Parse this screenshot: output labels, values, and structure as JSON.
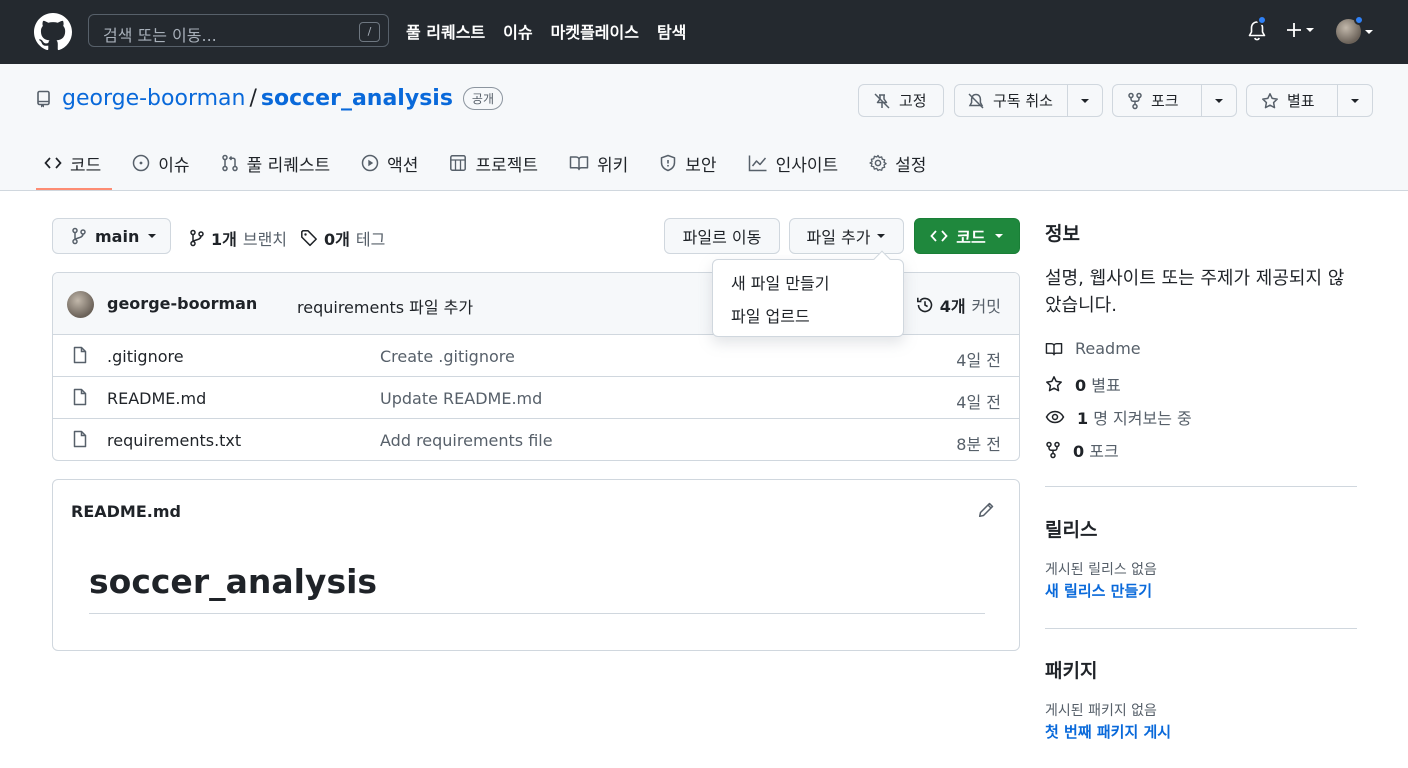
{
  "header": {
    "search_placeholder": "검색 또는 이동...",
    "search_shortcut": "/",
    "nav": [
      "풀 리퀘스트",
      "이슈",
      "마켓플레이스",
      "탐색"
    ],
    "plus_label": "+"
  },
  "repo": {
    "owner": "george-boorman",
    "separator": "/",
    "name": "soccer_analysis",
    "visibility": "공개",
    "buttons": {
      "pin": "고정",
      "unwatch": "구독 취소",
      "fork": "포크",
      "star": "별표"
    }
  },
  "tabs": [
    {
      "label": "코드",
      "icon": "code-icon"
    },
    {
      "label": "이슈",
      "icon": "issue-icon"
    },
    {
      "label": "풀 리퀘스트",
      "icon": "pull-request-icon"
    },
    {
      "label": "액션",
      "icon": "play-icon"
    },
    {
      "label": "프로젝트",
      "icon": "table-icon"
    },
    {
      "label": "위키",
      "icon": "book-icon"
    },
    {
      "label": "보안",
      "icon": "shield-icon"
    },
    {
      "label": "인사이트",
      "icon": "graph-icon"
    },
    {
      "label": "설정",
      "icon": "gear-icon"
    }
  ],
  "toolbar": {
    "branch": "main",
    "branches_count": "1개",
    "branches_label": "브랜치",
    "tags_count": "0개",
    "tags_label": "테그",
    "goto_file": "파일르 이동",
    "add_file": "파일 추가",
    "code": "코드"
  },
  "add_file_menu": [
    "새 파일 만들기",
    "파일 업르드"
  ],
  "latest_commit": {
    "author": "george-boorman",
    "message": "requirements 파일 추가",
    "count": "4개",
    "count_label": "커밋"
  },
  "files": [
    {
      "name": ".gitignore",
      "message": "Create .gitignore",
      "time": "4일 전"
    },
    {
      "name": "README.md",
      "message": "Update README.md",
      "time": "4일 전"
    },
    {
      "name": "requirements.txt",
      "message": "Add requirements file",
      "time": "8분 전"
    }
  ],
  "readme": {
    "filename": "README.md",
    "heading": "soccer_analysis"
  },
  "sidebar": {
    "about_title": "정보",
    "about_desc": "설명, 웹사이트 또는 주제가 제공되지 않았습니다.",
    "readme_label": "Readme",
    "stars_count": "0",
    "stars_label": "별표",
    "watchers_count": "1",
    "watchers_label": "명 지켜보는 중",
    "forks_count": "0",
    "forks_label": "포크",
    "releases_title": "릴리스",
    "releases_empty": "게시된 릴리스 없음",
    "releases_link": "새 릴리스 만들기",
    "packages_title": "패키지",
    "packages_empty": "게시된 패키지 없음",
    "packages_link": "첫 번째 패키지 게시"
  },
  "colors": {
    "header_bg": "#24292f",
    "accent_blue": "#0969da",
    "code_green": "#1f883d",
    "tab_underline": "#fd8c73",
    "notification_dot": "#2f81f7"
  }
}
